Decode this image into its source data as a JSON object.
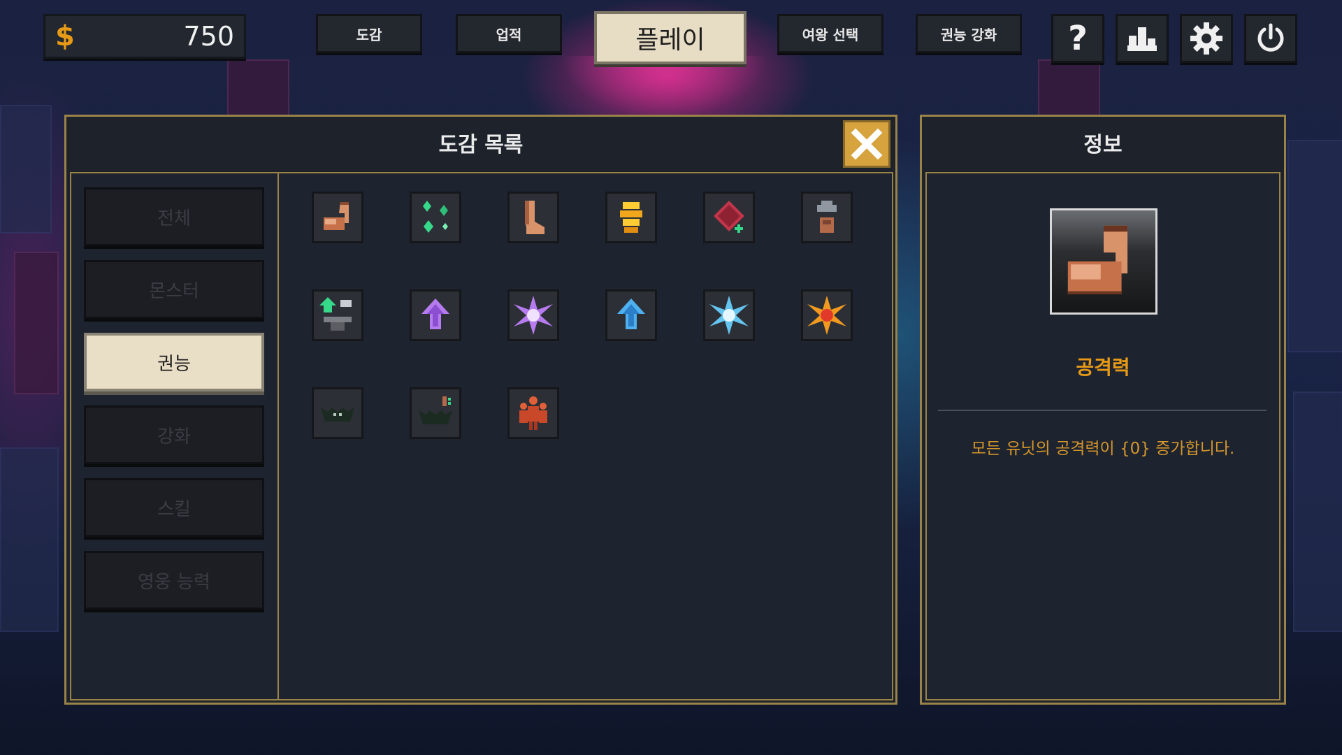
{
  "currency": {
    "icon": "dollar-icon",
    "value": "750",
    "color": "#e69a16"
  },
  "top_nav": {
    "codex": "도감",
    "achievements": "업적",
    "play": "플레이",
    "queen_select": "여왕 선택",
    "authority_upgrade": "권능 강화"
  },
  "top_icons": [
    "help-icon",
    "ranking-icon",
    "gear-icon",
    "power-icon"
  ],
  "help_glyph": "?",
  "codex_panel": {
    "title": "도감 목록",
    "categories": [
      {
        "label": "전체",
        "active": false
      },
      {
        "label": "몬스터",
        "active": false
      },
      {
        "label": "권능",
        "active": true
      },
      {
        "label": "강화",
        "active": false
      },
      {
        "label": "스킬",
        "active": false
      },
      {
        "label": "영웅 능력",
        "active": false
      }
    ],
    "items": [
      {
        "icon": "flexed-arm-icon"
      },
      {
        "icon": "green-sparkles-icon"
      },
      {
        "icon": "leg-icon"
      },
      {
        "icon": "gold-coins-icon"
      },
      {
        "icon": "red-book-icon"
      },
      {
        "icon": "tower-icon"
      },
      {
        "icon": "green-arrow-anvil-icon"
      },
      {
        "icon": "purple-up-arrow-icon"
      },
      {
        "icon": "purple-burst-icon"
      },
      {
        "icon": "blue-up-arrow-icon"
      },
      {
        "icon": "blue-burst-icon"
      },
      {
        "icon": "orange-burst-icon"
      },
      {
        "icon": "dark-bat-icon"
      },
      {
        "icon": "dark-bat-upgrade-icon"
      },
      {
        "icon": "orange-group-icon"
      }
    ]
  },
  "info_panel": {
    "title": "정보",
    "item_name": "공격력",
    "item_icon": "flexed-arm-icon",
    "description": "모든 유닛의 공격력이 {0} 증가합니다.",
    "accent_color": "#e69a16"
  }
}
